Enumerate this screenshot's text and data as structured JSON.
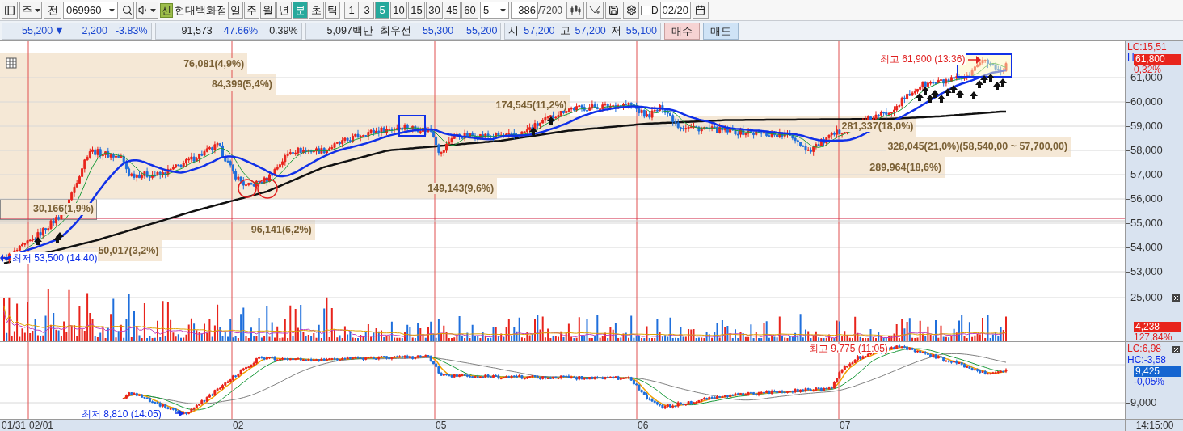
{
  "toolbar": {
    "market_select": "주",
    "all_button": "전",
    "code": "069960",
    "badge": "신",
    "name": "현대백화점",
    "periods": [
      {
        "label": "일",
        "selected": false
      },
      {
        "label": "주",
        "selected": false
      },
      {
        "label": "월",
        "selected": false
      },
      {
        "label": "년",
        "selected": false
      },
      {
        "label": "분",
        "selected": true
      },
      {
        "label": "초",
        "selected": false
      },
      {
        "label": "틱",
        "selected": false
      }
    ],
    "intervals": [
      {
        "label": "1",
        "selected": false
      },
      {
        "label": "3",
        "selected": false
      },
      {
        "label": "5",
        "selected": true
      },
      {
        "label": "10",
        "selected": false
      },
      {
        "label": "15",
        "selected": false
      },
      {
        "label": "30",
        "selected": false
      },
      {
        "label": "45",
        "selected": false
      },
      {
        "label": "60",
        "selected": false
      }
    ],
    "interval_select": "5",
    "count": "386",
    "count_total": "/7200",
    "date_checkbox": {
      "label": "D",
      "checked": false
    },
    "date": "02/20"
  },
  "quote": {
    "price": "55,200",
    "arrow": "▼",
    "change": "2,200",
    "change_rate": "-3.83%",
    "volume": "91,573",
    "volume_ratio": "47.66%",
    "turnover": "0.39%",
    "amount": "5,097백만",
    "best_label": "최우선",
    "ask": "55,300",
    "bid": "55,200",
    "prices": [
      {
        "label": "시",
        "value": "57,200"
      },
      {
        "label": "고",
        "value": "57,200"
      },
      {
        "label": "저",
        "value": "55,100"
      }
    ],
    "buy": "매수",
    "sell": "매도"
  },
  "price_pane": {
    "lc": "LC:15,51",
    "hc": "H",
    "current": "61,800",
    "current_rate": "0,32%",
    "yticks": [
      "61,000",
      "60,000",
      "59,000",
      "58,000",
      "57,000",
      "56,000",
      "55,000",
      "54,000",
      "53,000"
    ],
    "volume_profile": [
      {
        "label": "76,081(4,9%)",
        "level": 0.22,
        "highlighted": false
      },
      {
        "label": "84,399(5,4%)",
        "level": 0.245,
        "highlighted": false
      },
      {
        "label": "174,545(11,2%)",
        "level": 0.507,
        "highlighted": false
      },
      {
        "label": "281,337(18,0%)",
        "level": 0.815,
        "highlighted": false
      },
      {
        "label": "328,045(21,0%)(58,540,00 ~ 57,700,00)",
        "level": 0.952,
        "highlighted": false
      },
      {
        "label": "289,964(18,6%)",
        "level": 0.84,
        "highlighted": false
      },
      {
        "label": "149,143(9,6%)",
        "level": 0.442,
        "highlighted": false
      },
      {
        "label": "30,166(1,9%)",
        "level": 0.086,
        "highlighted": true
      },
      {
        "label": "96,141(6,2%)",
        "level": 0.28,
        "highlighted": false
      },
      {
        "label": "50,017(3,2%)",
        "level": 0.144,
        "highlighted": false
      }
    ],
    "high_note": "최고 61,900 (13:36)",
    "low_note": "최저 53,500 (14:40)"
  },
  "volume_pane": {
    "ytick": "25,000",
    "current": "4,238",
    "current_rate": "127,84%"
  },
  "indicator_pane": {
    "lc": "LC:6,98",
    "hc": "HC:-3,58",
    "current": "9,425",
    "current_rate": "-0,05%",
    "ytick": "9,000",
    "high_note": "최고 9,775 (11:05)",
    "low_note": "최저 8,810 (14:05)"
  },
  "time_axis": {
    "labels": [
      "01/31",
      "02/01",
      "02",
      "05",
      "06",
      "07"
    ],
    "current_time": "14:15:00"
  }
}
